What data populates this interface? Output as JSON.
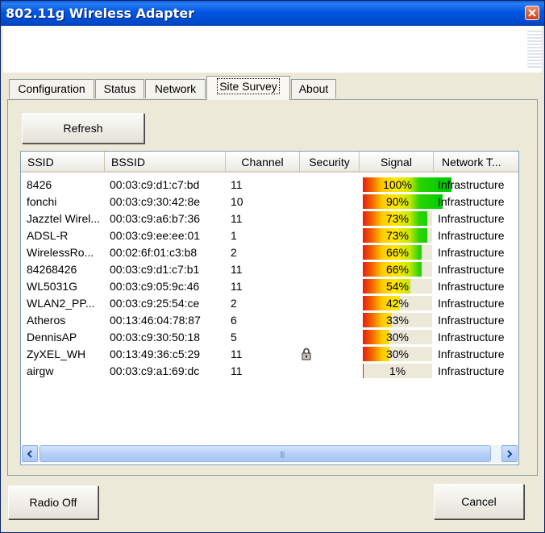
{
  "window": {
    "title": "802.11g Wireless Adapter"
  },
  "icons": {
    "close": "close-icon",
    "lock": "lock-icon",
    "scroll_left": "arrow-left-icon",
    "scroll_right": "arrow-right-icon"
  },
  "tabs": [
    {
      "label": "Configuration",
      "active": false
    },
    {
      "label": "Status",
      "active": false
    },
    {
      "label": "Network",
      "active": false
    },
    {
      "label": "Site Survey",
      "active": true
    },
    {
      "label": "About",
      "active": false
    }
  ],
  "refresh_label": "Refresh",
  "table": {
    "columns": [
      "SSID",
      "BSSID",
      "Channel",
      "Security",
      "Signal",
      "Network T..."
    ],
    "rows": [
      {
        "ssid": "8426",
        "bssid": "00:03:c9:d1:c7:bd",
        "channel": "11",
        "secured": false,
        "signal": 100,
        "signal_text": "100%",
        "network_type": "Infrastructure"
      },
      {
        "ssid": "fonchi",
        "bssid": "00:03:c9:30:42:8e",
        "channel": "10",
        "secured": false,
        "signal": 90,
        "signal_text": "90%",
        "network_type": "Infrastructure"
      },
      {
        "ssid": "Jazztel Wirel...",
        "bssid": "00:03:c9:a6:b7:36",
        "channel": "11",
        "secured": false,
        "signal": 73,
        "signal_text": "73%",
        "network_type": "Infrastructure"
      },
      {
        "ssid": "ADSL-R",
        "bssid": "00:03:c9:ee:ee:01",
        "channel": "1",
        "secured": false,
        "signal": 73,
        "signal_text": "73%",
        "network_type": "Infrastructure"
      },
      {
        "ssid": "WirelessRo...",
        "bssid": "00:02:6f:01:c3:b8",
        "channel": "2",
        "secured": false,
        "signal": 66,
        "signal_text": "66%",
        "network_type": "Infrastructure"
      },
      {
        "ssid": "84268426",
        "bssid": "00:03:c9:d1:c7:b1",
        "channel": "11",
        "secured": false,
        "signal": 66,
        "signal_text": "66%",
        "network_type": "Infrastructure"
      },
      {
        "ssid": "WL5031G",
        "bssid": "00:03:c9:05:9c:46",
        "channel": "11",
        "secured": false,
        "signal": 54,
        "signal_text": "54%",
        "network_type": "Infrastructure"
      },
      {
        "ssid": "WLAN2_PP...",
        "bssid": "00:03:c9:25:54:ce",
        "channel": "2",
        "secured": false,
        "signal": 42,
        "signal_text": "42%",
        "network_type": "Infrastructure"
      },
      {
        "ssid": "Atheros",
        "bssid": "00:13:46:04:78:87",
        "channel": "6",
        "secured": false,
        "signal": 33,
        "signal_text": "33%",
        "network_type": "Infrastructure"
      },
      {
        "ssid": "DennisAP",
        "bssid": "00:03:c9:30:50:18",
        "channel": "5",
        "secured": false,
        "signal": 30,
        "signal_text": "30%",
        "network_type": "Infrastructure"
      },
      {
        "ssid": "ZyXEL_WH",
        "bssid": "00:13:49:36:c5:29",
        "channel": "11",
        "secured": true,
        "signal": 30,
        "signal_text": "30%",
        "network_type": "Infrastructure"
      },
      {
        "ssid": "airgw",
        "bssid": "00:03:c9:a1:69:dc",
        "channel": "11",
        "secured": false,
        "signal": 1,
        "signal_text": "1%",
        "network_type": "Infrastructure"
      }
    ]
  },
  "footer": {
    "radio_off_label": "Radio Off",
    "cancel_label": "Cancel"
  }
}
